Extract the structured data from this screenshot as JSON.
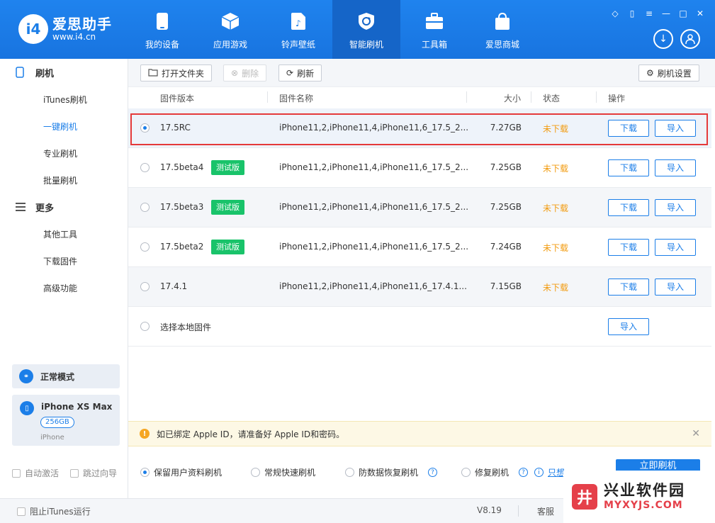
{
  "app": {
    "logo_mark": "i4",
    "title": "爱思助手",
    "url": "www.i4.cn"
  },
  "nav": [
    {
      "label": "我的设备",
      "icon": "phone-icon"
    },
    {
      "label": "应用游戏",
      "icon": "cube-icon"
    },
    {
      "label": "铃声壁纸",
      "icon": "music-file-icon"
    },
    {
      "label": "智能刷机",
      "icon": "refresh-shield-icon"
    },
    {
      "label": "工具箱",
      "icon": "toolbox-icon"
    },
    {
      "label": "爱思商城",
      "icon": "shopping-bag-icon"
    }
  ],
  "sidebar": {
    "flash_section": "刷机",
    "flash_items": [
      "iTunes刷机",
      "一键刷机",
      "专业刷机",
      "批量刷机"
    ],
    "more_section": "更多",
    "more_items": [
      "其他工具",
      "下载固件",
      "高级功能"
    ],
    "mode": "正常模式",
    "device": {
      "name": "iPhone XS Max",
      "storage": "256GB",
      "type": "iPhone"
    },
    "auto_activate": "自动激活",
    "skip_guide": "跳过向导"
  },
  "toolbar": {
    "open_folder": "打开文件夹",
    "delete": "删除",
    "refresh": "刷新",
    "settings": "刷机设置"
  },
  "table": {
    "headers": {
      "version": "固件版本",
      "name": "固件名称",
      "size": "大小",
      "status": "状态",
      "action": "操作"
    },
    "download_label": "下载",
    "import_label": "导入",
    "rows": [
      {
        "version": "17.5RC",
        "beta": "",
        "name": "iPhone11,2,iPhone11,4,iPhone11,6_17.5_2...",
        "size": "7.27GB",
        "status": "未下载"
      },
      {
        "version": "17.5beta4",
        "beta": "测试版",
        "name": "iPhone11,2,iPhone11,4,iPhone11,6_17.5_2...",
        "size": "7.25GB",
        "status": "未下载"
      },
      {
        "version": "17.5beta3",
        "beta": "测试版",
        "name": "iPhone11,2,iPhone11,4,iPhone11,6_17.5_2...",
        "size": "7.25GB",
        "status": "未下载"
      },
      {
        "version": "17.5beta2",
        "beta": "测试版",
        "name": "iPhone11,2,iPhone11,4,iPhone11,6_17.5_2...",
        "size": "7.24GB",
        "status": "未下载"
      },
      {
        "version": "17.4.1",
        "beta": "",
        "name": "iPhone11,2,iPhone11,4,iPhone11,6_17.4.1...",
        "size": "7.15GB",
        "status": "未下载"
      }
    ],
    "local_firmware": "选择本地固件"
  },
  "notice": "如已绑定 Apple ID，请准备好 Apple ID和密码。",
  "options": {
    "keep_data": "保留用户资料刷机",
    "quick": "常规快速刷机",
    "anti_recovery": "防数据恢复刷机",
    "repair": "修复刷机",
    "only_link": "只想",
    "flash_button": "立即刷机"
  },
  "statusbar": {
    "block_itunes": "阻止iTunes运行",
    "version": "V8.19",
    "service": "客服"
  },
  "watermark": {
    "logo": "井",
    "cn": "兴业软件园",
    "en": "MYXYJS.COM"
  },
  "colors": {
    "accent": "#1b7ee8",
    "status_orange": "#f29b0f",
    "beta_green": "#19c36a",
    "highlight_red": "#e53a3a"
  }
}
